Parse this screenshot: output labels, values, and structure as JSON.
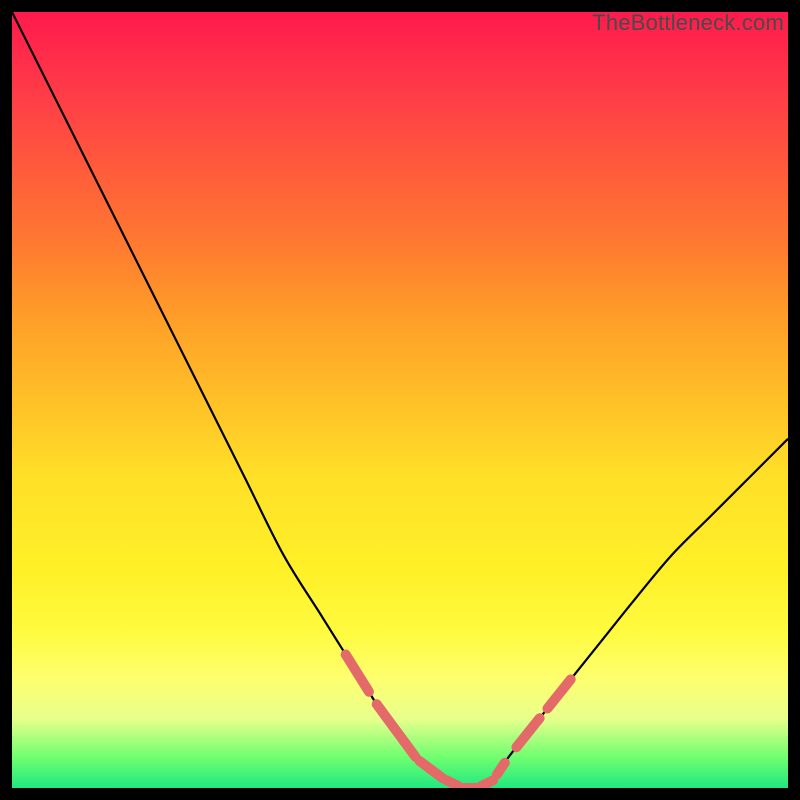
{
  "watermark": "TheBottleneck.com",
  "chart_data": {
    "type": "line",
    "title": "",
    "xlabel": "",
    "ylabel": "",
    "x": [
      0,
      5,
      10,
      15,
      20,
      25,
      30,
      35,
      40,
      45,
      50,
      52,
      54,
      56,
      58,
      60,
      62,
      64,
      68,
      72,
      76,
      80,
      85,
      90,
      95,
      100
    ],
    "y": [
      100,
      90,
      80,
      70,
      60,
      50,
      40,
      30,
      22,
      14,
      6,
      4,
      2,
      1,
      0,
      0,
      1,
      4,
      9,
      14,
      19,
      24,
      30,
      35,
      40,
      45
    ],
    "xlim": [
      0,
      100
    ],
    "ylim": [
      0,
      100
    ],
    "highlight_segments": [
      {
        "x0": 43,
        "x1": 46
      },
      {
        "x0": 47,
        "x1": 52
      },
      {
        "x0": 52.5,
        "x1": 55.5
      },
      {
        "x0": 56,
        "x1": 57.5
      },
      {
        "x0": 58,
        "x1": 60
      },
      {
        "x0": 60.5,
        "x1": 62
      },
      {
        "x0": 62.5,
        "x1": 63.5
      },
      {
        "x0": 65,
        "x1": 68
      },
      {
        "x0": 69,
        "x1": 72
      }
    ],
    "gradient_stops": [
      {
        "pos": 0,
        "color": "#ff1a4d"
      },
      {
        "pos": 50,
        "color": "#ffc028"
      },
      {
        "pos": 100,
        "color": "#20e880"
      }
    ]
  }
}
